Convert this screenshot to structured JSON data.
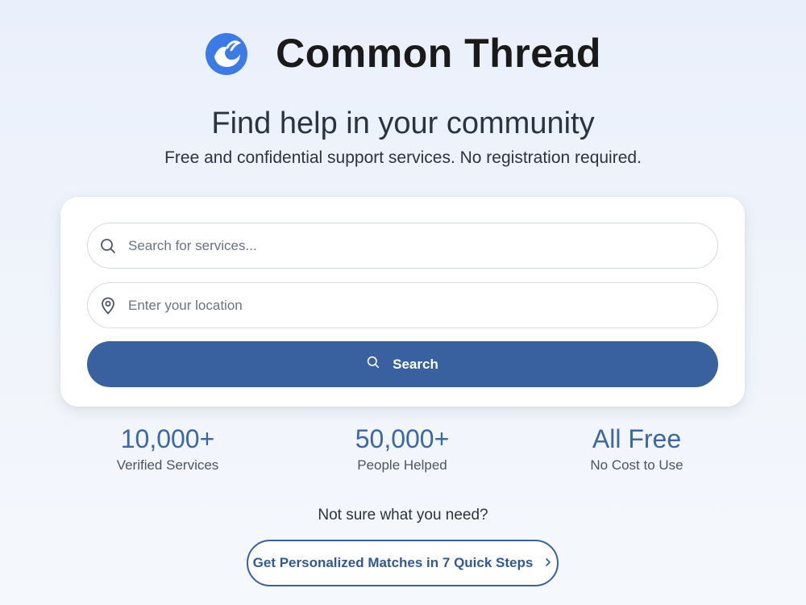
{
  "brand": {
    "name": "Common Thread",
    "logo_icon": "hand-wave-logo-icon",
    "logo_color": "#3a7be8"
  },
  "hero": {
    "headline": "Find help in your community",
    "subline": "Free and confidential support services. No registration required."
  },
  "search_form": {
    "service_placeholder": "Search for services...",
    "service_icon": "search-icon",
    "location_placeholder": "Enter your location",
    "location_icon": "map-pin-icon",
    "button_label": "Search",
    "button_icon": "search-icon",
    "button_color": "#3961a0"
  },
  "stats": [
    {
      "value": "10,000+",
      "label": "Verified Services"
    },
    {
      "value": "50,000+",
      "label": "People Helped"
    },
    {
      "value": "All Free",
      "label": "No Cost to Use"
    }
  ],
  "guidance": {
    "question": "Not sure what you need?",
    "cta_label": "Get Personalized Matches in 7 Quick Steps",
    "cta_icon": "chevron-right-icon"
  },
  "colors": {
    "accent": "#3961a0",
    "stat_text": "#3a67a8"
  }
}
